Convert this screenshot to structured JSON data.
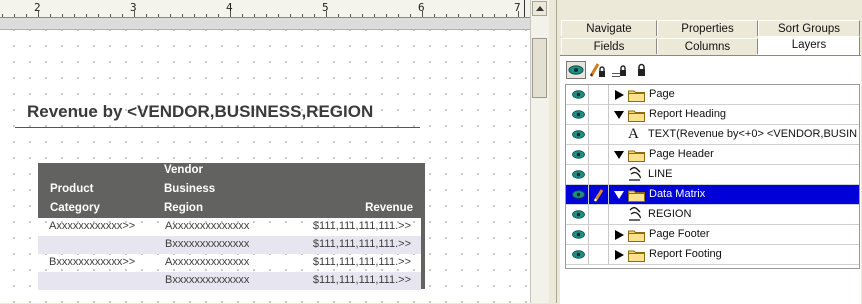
{
  "ruler": {
    "marks": [
      "2",
      "3",
      "4",
      "5",
      "6",
      "7"
    ]
  },
  "report": {
    "title": "Revenue by <VENDOR,BUSINESS,REGION",
    "matrix": {
      "headers": {
        "product": [
          "Product",
          "Category"
        ],
        "vendor": [
          "Vendor",
          "Business",
          "Region"
        ],
        "revenue": "Revenue"
      },
      "rows": [
        {
          "product": "Axxxxxxxxxxxx>>",
          "region": "Axxxxxxxxxxxxxx",
          "revenue": "$111,111,111,111.>>"
        },
        {
          "product": "",
          "region": "Bxxxxxxxxxxxxxx",
          "revenue": "$111,111,111,111.>>"
        },
        {
          "product": "Bxxxxxxxxxxxx>>",
          "region": "Axxxxxxxxxxxxxx",
          "revenue": "$111,111,111,111.>>"
        },
        {
          "product": "",
          "region": "Bxxxxxxxxxxxxxx",
          "revenue": "$111,111,111,111.>>"
        }
      ]
    }
  },
  "panel": {
    "tabs": {
      "navigate": "Navigate",
      "properties": "Properties",
      "sort_groups": "Sort Groups",
      "fields": "Fields",
      "columns": "Columns",
      "layers": "Layers"
    },
    "active_tab": "Layers",
    "layers": [
      {
        "label": "Page",
        "kind": "folder",
        "expander": "collapsed"
      },
      {
        "label": "Report Heading",
        "kind": "folder",
        "expander": "expanded"
      },
      {
        "label": "TEXT(Revenue by<+0> <VENDOR,BUSIN",
        "kind": "text",
        "icon": "A"
      },
      {
        "label": "Page Header",
        "kind": "folder",
        "expander": "expanded"
      },
      {
        "label": "LINE",
        "kind": "line"
      },
      {
        "label": "Data Matrix",
        "kind": "folder",
        "expander": "expanded",
        "selected": true
      },
      {
        "label": "REGION",
        "kind": "field"
      },
      {
        "label": "Page Footer",
        "kind": "folder",
        "expander": "collapsed"
      },
      {
        "label": "Report Footing",
        "kind": "folder",
        "expander": "collapsed"
      }
    ],
    "colors": {
      "selection": "#0000d8",
      "eye": "#1e8f86",
      "folder": "#f5d76e"
    }
  }
}
